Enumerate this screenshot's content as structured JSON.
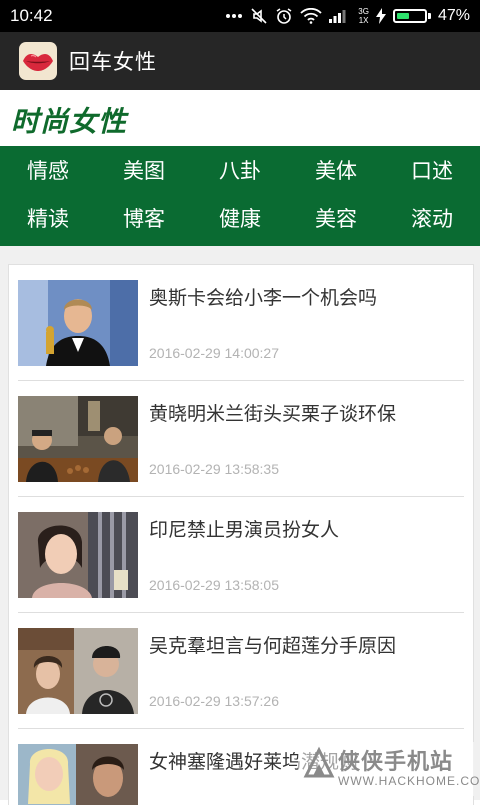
{
  "status_bar": {
    "time": "10:42",
    "network_top": "3G",
    "network_bottom": "1X",
    "battery_percent": "47%",
    "battery_level": 0.47,
    "icons": [
      "more-icon",
      "mute-icon",
      "alarm-icon",
      "wifi-icon",
      "signal-icon",
      "charging-icon",
      "battery-icon"
    ]
  },
  "app_bar": {
    "title": "回车女性",
    "logo_icon": "lips-icon"
  },
  "brand": {
    "title": "时尚女性",
    "color": "#0f6a2c"
  },
  "nav": {
    "background": "#0a6b32",
    "categories": [
      "情感",
      "美图",
      "八卦",
      "美体",
      "口述",
      "精读",
      "博客",
      "健康",
      "美容",
      "滚动"
    ]
  },
  "articles": [
    {
      "title": "奥斯卡会给小李一个机会吗",
      "date": "2016-02-29 14:00:27"
    },
    {
      "title": "黄晓明米兰街头买栗子谈环保",
      "date": "2016-02-29 13:58:35"
    },
    {
      "title": "印尼禁止男演员扮女人",
      "date": "2016-02-29 13:58:05"
    },
    {
      "title": "吴克羣坦言与何超莲分手原因",
      "date": "2016-02-29 13:57:26"
    },
    {
      "title": "女神塞隆遇好莱坞潜规则",
      "date": ""
    }
  ],
  "watermark": {
    "text": "侠侠手机站",
    "url": "WWW.HACKHOME.COM"
  }
}
